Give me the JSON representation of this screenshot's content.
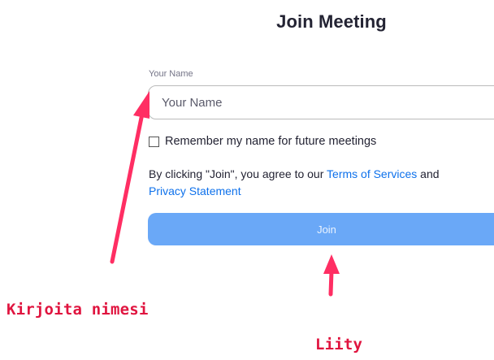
{
  "page": {
    "title": "Join Meeting"
  },
  "form": {
    "name_label": "Your Name",
    "name_placeholder": "Your Name",
    "remember_label": "Remember my name for future meetings",
    "remember_checked": false,
    "terms_prefix": "By clicking \"Join\", you agree to our ",
    "terms_link": "Terms of Services",
    "terms_and": " and",
    "privacy_link": "Privacy Statement",
    "join_label": "Join"
  },
  "annotations": {
    "name_hint": "Kirjoita nimesi",
    "join_hint": "Liity",
    "color": "#e0143f"
  },
  "colors": {
    "join_button": "#6aa8f7",
    "link": "#0e71eb"
  }
}
